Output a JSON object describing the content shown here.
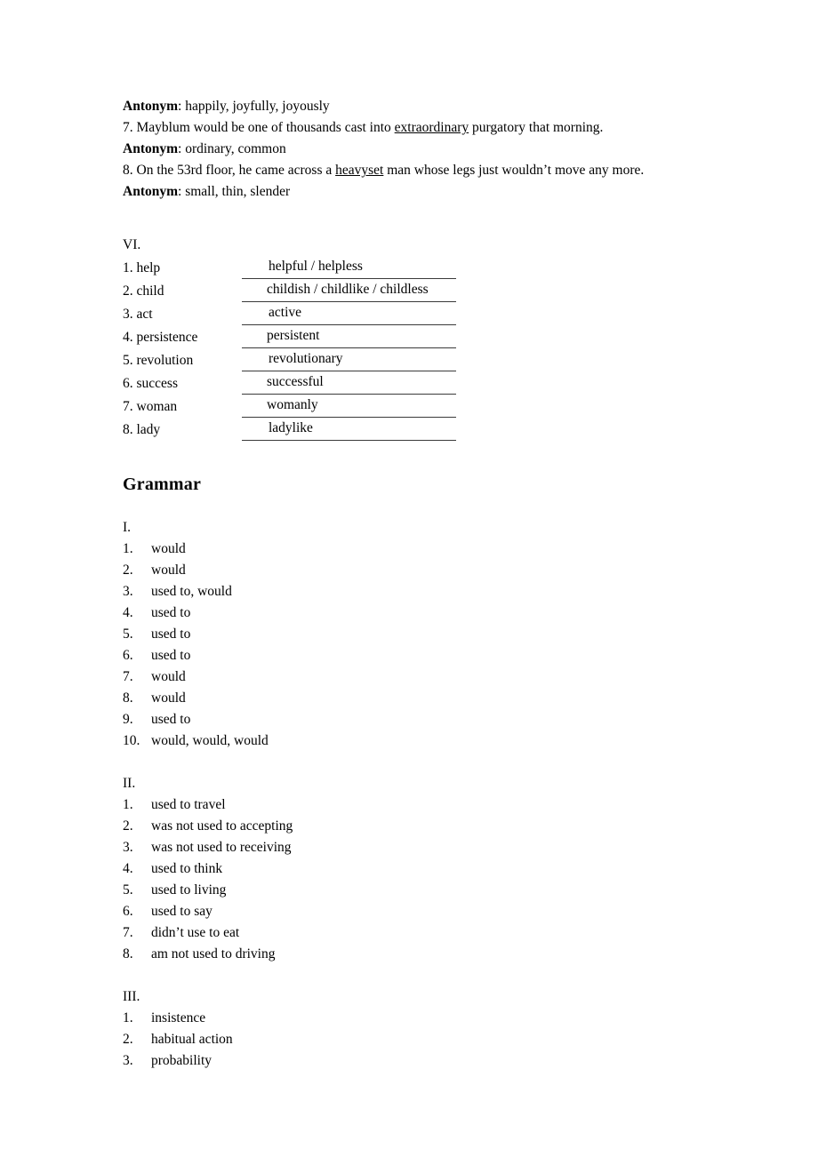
{
  "document": {
    "background_color": "#ffffff",
    "text_color": "#000000",
    "rule_color": "#3a3a3a"
  },
  "vocabulary_block": {
    "lines": [
      {
        "label": "Antonym",
        "separator": ":",
        "text": " happily, joyfully, joyously"
      },
      {
        "number": "7.",
        "text": " Mayblum would be one of thousands cast into ",
        "underlined": "extraordinary",
        "text_after": " purgatory that morning."
      },
      {
        "label": "Antonym",
        "separator": ":",
        "text": " ordinary, common"
      },
      {
        "number": "8.",
        "text": " On the 53rd floor, he came across a ",
        "underlined": "heavyset",
        "text_after": " man whose legs just wouldn’t move any more."
      },
      {
        "label": "Antonym",
        "separator": ":",
        "text": " small, thin, slender"
      }
    ]
  },
  "section_vi": {
    "heading": "VI.",
    "rows": [
      {
        "cue": "1. help",
        "answer": "helpful / helpless"
      },
      {
        "cue": "2. child",
        "answer": "childish / childlike / childless"
      },
      {
        "cue": "3. act",
        "answer": "active"
      },
      {
        "cue": "4. persistence",
        "answer": "persistent"
      },
      {
        "cue": "5. revolution",
        "answer": "revolutionary"
      },
      {
        "cue": "6. success",
        "answer": "successful"
      },
      {
        "cue": "7. woman",
        "answer": "womanly"
      },
      {
        "cue": "8. lady",
        "answer": "ladylike"
      }
    ]
  },
  "grammar": {
    "title": "Grammar",
    "section_i": {
      "heading": "I.",
      "items": [
        {
          "index": "1.",
          "text": "would"
        },
        {
          "index": "2.",
          "text": "would"
        },
        {
          "index": "3.",
          "text": "used to, would"
        },
        {
          "index": "4.",
          "text": "used to"
        },
        {
          "index": "5.",
          "text": "used to"
        },
        {
          "index": "6.",
          "text": "used to"
        },
        {
          "index": "7.",
          "text": "would"
        },
        {
          "index": "8.",
          "text": "would"
        },
        {
          "index": "9.",
          "text": "used to"
        },
        {
          "index": "10.",
          "text": "would, would, would"
        }
      ]
    },
    "section_ii": {
      "heading": "II.",
      "items": [
        {
          "index": "1.",
          "text": "used to travel"
        },
        {
          "index": "2.",
          "text": "was not used to accepting"
        },
        {
          "index": "3.",
          "text": "was not used to receiving"
        },
        {
          "index": "4.",
          "text": "used to think"
        },
        {
          "index": "5.",
          "text": "used to living"
        },
        {
          "index": "6.",
          "text": "used to say"
        },
        {
          "index": "7.",
          "text": "didn’t use to eat"
        },
        {
          "index": "8.",
          "text": "am not used to driving"
        }
      ]
    },
    "section_iii": {
      "heading": "III.",
      "items": [
        {
          "index": "1.",
          "text": "insistence"
        },
        {
          "index": "2.",
          "text": "habitual action"
        },
        {
          "index": "3.",
          "text": "probability"
        }
      ]
    }
  }
}
